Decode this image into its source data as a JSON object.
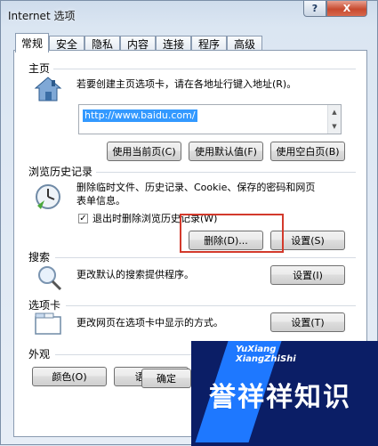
{
  "window": {
    "title": "Internet 选项",
    "help_label": "?",
    "close_label": "X"
  },
  "tabs": [
    {
      "label": "常规",
      "active": true
    },
    {
      "label": "安全"
    },
    {
      "label": "隐私"
    },
    {
      "label": "内容"
    },
    {
      "label": "连接"
    },
    {
      "label": "程序"
    },
    {
      "label": "高级"
    }
  ],
  "homepage": {
    "label": "主页",
    "icon": "house-icon",
    "instruction": "若要创建主页选项卡，请在各地址行键入地址(R)。",
    "url": "http://www.baidu.com/",
    "buttons": [
      "使用当前页(C)",
      "使用默认值(F)",
      "使用空白页(B)"
    ]
  },
  "history": {
    "label": "浏览历史记录",
    "icon": "history-clock-icon",
    "description_line1": "删除临时文件、历史记录、Cookie、保存的密码和网页",
    "description_line2": "表单信息。",
    "checkbox_label": "退出时删除浏览历史记录(W)",
    "checkbox_checked": true,
    "delete_button": "删除(D)...",
    "settings_button": "设置(S)"
  },
  "search": {
    "label": "搜索",
    "icon": "magnifier-icon",
    "description": "更改默认的搜索提供程序。",
    "settings_button": "设置(I)"
  },
  "tabs_section": {
    "label": "选项卡",
    "icon": "tabs-window-icon",
    "description": "更改网页在选项卡中显示的方式。",
    "settings_button": "设置(T)"
  },
  "appearance": {
    "label": "外观",
    "buttons": [
      "颜色(O)",
      "语言(L)"
    ]
  },
  "footer": {
    "ok_button": "确定"
  },
  "watermark": {
    "en_line1": "YuXiang",
    "en_line2": "XiangZhiShi",
    "cn_text": "誉祥祥知识"
  }
}
